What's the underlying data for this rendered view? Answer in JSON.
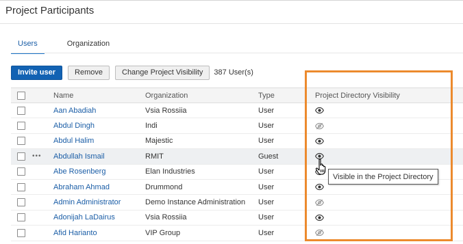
{
  "page": {
    "title": "Project Participants"
  },
  "tabs": [
    {
      "label": "Users",
      "active": true
    },
    {
      "label": "Organization",
      "active": false
    }
  ],
  "toolbar": {
    "invite_label": "Invite user",
    "remove_label": "Remove",
    "change_visibility_label": "Change Project Visibility",
    "user_count": "387 User(s)"
  },
  "table": {
    "columns": {
      "name": "Name",
      "organization": "Organization",
      "type": "Type",
      "visibility": "Project Directory Visibility"
    },
    "rows": [
      {
        "name": "Aan Abadiah",
        "organization": "Vsia Rossiia",
        "type": "User",
        "visibility": "visible"
      },
      {
        "name": "Abdul Dingh",
        "organization": "Indi",
        "type": "User",
        "visibility": "hidden"
      },
      {
        "name": "Abdul Halim",
        "organization": "Majestic",
        "type": "User",
        "visibility": "visible"
      },
      {
        "name": "Abdullah Ismail",
        "organization": "RMIT",
        "type": "Guest",
        "visibility": "visible"
      },
      {
        "name": "Abe Rosenberg",
        "organization": "Elan Industries",
        "type": "User",
        "visibility": "visible"
      },
      {
        "name": "Abraham Ahmad",
        "organization": "Drummond",
        "type": "User",
        "visibility": "visible"
      },
      {
        "name": "Admin Administrator",
        "organization": "Demo Instance Administration",
        "type": "User",
        "visibility": "hidden"
      },
      {
        "name": "Adonijah LaDairus",
        "organization": "Vsia Rossiia",
        "type": "User",
        "visibility": "visible"
      },
      {
        "name": "Afid Harianto",
        "organization": "VIP Group",
        "type": "User",
        "visibility": "hidden"
      }
    ],
    "hovered_row_index": 3,
    "row_menu_glyph": "•••"
  },
  "tooltip": {
    "text": "Visible in the Project Directory"
  },
  "colors": {
    "accent": "#1a73c8",
    "link": "#1a5da6",
    "highlight": "#ec8a2d",
    "primary_button": "#1262b3"
  },
  "icons": {
    "visible": "eye-icon",
    "hidden": "eye-slash-icon",
    "cursor": "hand-pointer-icon"
  }
}
